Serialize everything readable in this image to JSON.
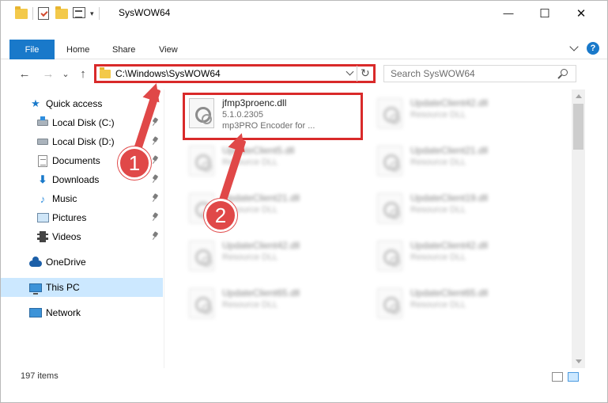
{
  "window": {
    "title": "SysWOW64",
    "qat_dropdown": "▾",
    "minimize": "—",
    "maximize": "☐",
    "close": "✕"
  },
  "ribbon": {
    "file": "File",
    "tabs": [
      "Home",
      "Share",
      "View"
    ],
    "help": "?"
  },
  "nav": {
    "back": "←",
    "forward": "→",
    "recent": "⌄",
    "up": "↑",
    "address": "C:\\Windows\\SysWOW64",
    "refresh": "↻",
    "search_placeholder": "Search SysWOW64"
  },
  "sidebar": {
    "items": [
      {
        "label": "Quick access",
        "icon": "star-icon"
      },
      {
        "label": "Local Disk (C:)",
        "icon": "drive-icon"
      },
      {
        "label": "Local Disk (D:)",
        "icon": "drive-icon"
      },
      {
        "label": "Documents",
        "icon": "documents-icon"
      },
      {
        "label": "Downloads",
        "icon": "download-icon"
      },
      {
        "label": "Music",
        "icon": "music-icon"
      },
      {
        "label": "Pictures",
        "icon": "pictures-icon"
      },
      {
        "label": "Videos",
        "icon": "videos-icon"
      },
      {
        "label": "OneDrive",
        "icon": "cloud-icon"
      },
      {
        "label": "This PC",
        "icon": "computer-icon"
      },
      {
        "label": "Network",
        "icon": "network-icon"
      }
    ]
  },
  "files": [
    {
      "name": "jfmp3proenc.dll",
      "line2": "5.1.0.2305",
      "line3": "mp3PRO Encoder for ..."
    },
    {
      "name": "UpdateClient42.dll",
      "line2": "Resource DLL"
    },
    {
      "name": "UpdateClient5.dll",
      "line2": "Resource DLL"
    },
    {
      "name": "UpdateClient21.dll",
      "line2": "Resource DLL"
    },
    {
      "name": "UpdateClient21.dll",
      "line2": "Resource DLL"
    },
    {
      "name": "UpdateClient19.dll",
      "line2": "Resource DLL"
    },
    {
      "name": "UpdateClient42.dll",
      "line2": "Resource DLL"
    },
    {
      "name": "UpdateClient42.dll",
      "line2": "Resource DLL"
    },
    {
      "name": "UpdateClient65.dll",
      "line2": "Resource DLL"
    },
    {
      "name": "UpdateClient65.dll",
      "line2": "Resource DLL"
    }
  ],
  "status": {
    "count": "197 items"
  },
  "annotations": {
    "step1": "1",
    "step2": "2",
    "color": "#e04848"
  },
  "colors": {
    "accent": "#1979ca",
    "highlight_border": "#d92a2a",
    "selected_bg": "#cce8ff"
  }
}
